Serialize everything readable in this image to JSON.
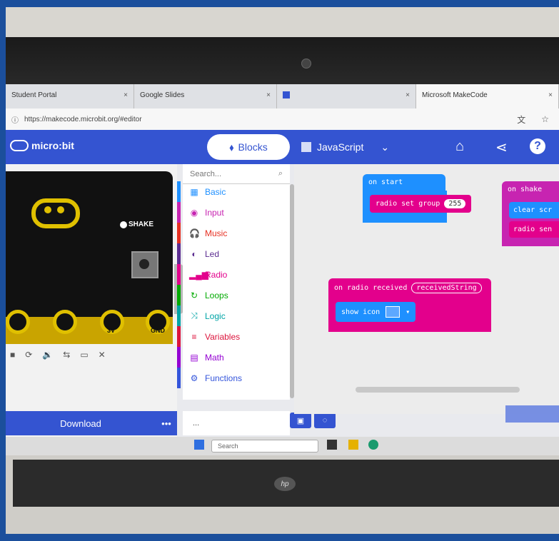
{
  "browser": {
    "tabs": [
      {
        "label": "Student Portal",
        "active": false
      },
      {
        "label": "Google Slides",
        "active": false
      },
      {
        "label": "",
        "active": false
      },
      {
        "label": "Microsoft MakeCode",
        "active": true
      }
    ],
    "close_glyph": "×",
    "url": "https://makecode.microbit.org/#editor"
  },
  "header": {
    "logo_text": "micro:bit",
    "blocks_label": "Blocks",
    "javascript_label": "JavaScript",
    "dropdown_glyph": "⌄",
    "icons": [
      "home-icon",
      "share-icon",
      "help-icon"
    ]
  },
  "simulator": {
    "shake_label": "SHAKE",
    "pin_labels": [
      "",
      "",
      "3V",
      "GND"
    ],
    "controls": [
      "■",
      "⟳",
      "🔉",
      "⇆",
      "▭",
      "✕"
    ]
  },
  "download": {
    "label": "Download",
    "more": "•••"
  },
  "toolbox": {
    "search_placeholder": "Search...",
    "categories": [
      {
        "label": "Basic",
        "color": "#1e90ff",
        "icon": "grid-icon"
      },
      {
        "label": "Input",
        "color": "#c724b1",
        "icon": "input-icon"
      },
      {
        "label": "Music",
        "color": "#e63022",
        "icon": "headphones-icon"
      },
      {
        "label": "Led",
        "color": "#5c2d91",
        "icon": "toggle-icon"
      },
      {
        "label": "Radio",
        "color": "#e3008c",
        "icon": "signal-icon"
      },
      {
        "label": "Loops",
        "color": "#00aa00",
        "icon": "loop-icon"
      },
      {
        "label": "Logic",
        "color": "#00a4a6",
        "icon": "shuffle-icon"
      },
      {
        "label": "Variables",
        "color": "#dc143c",
        "icon": "list-icon"
      },
      {
        "label": "Math",
        "color": "#9400d3",
        "icon": "calculator-icon"
      },
      {
        "label": "Functions",
        "color": "#3455db",
        "icon": "functions-icon"
      }
    ]
  },
  "project": {
    "name": "...",
    "save_icon": "save-icon",
    "github_icon": "github-icon"
  },
  "workspace": {
    "blocks": [
      {
        "name": "on-start",
        "header": "on start",
        "body": "radio set group",
        "value": "255",
        "hat_color": "#1e90ff",
        "body_color": "#e3008c"
      },
      {
        "name": "on-shake",
        "header": "on shake",
        "body": "clear scr",
        "body2": "radio sen",
        "hat_color": "#c724b1",
        "body_color": "#1e90ff"
      },
      {
        "name": "on-radio-received",
        "header": "on radio received",
        "value": "receivedString",
        "body": "show icon",
        "hat_color": "#e3008c",
        "body_color": "#1e90ff"
      }
    ]
  },
  "taskbar": {
    "search_placeholder": "Search"
  },
  "colors": {
    "header": "#3454d1",
    "accent": "#3454d1"
  }
}
